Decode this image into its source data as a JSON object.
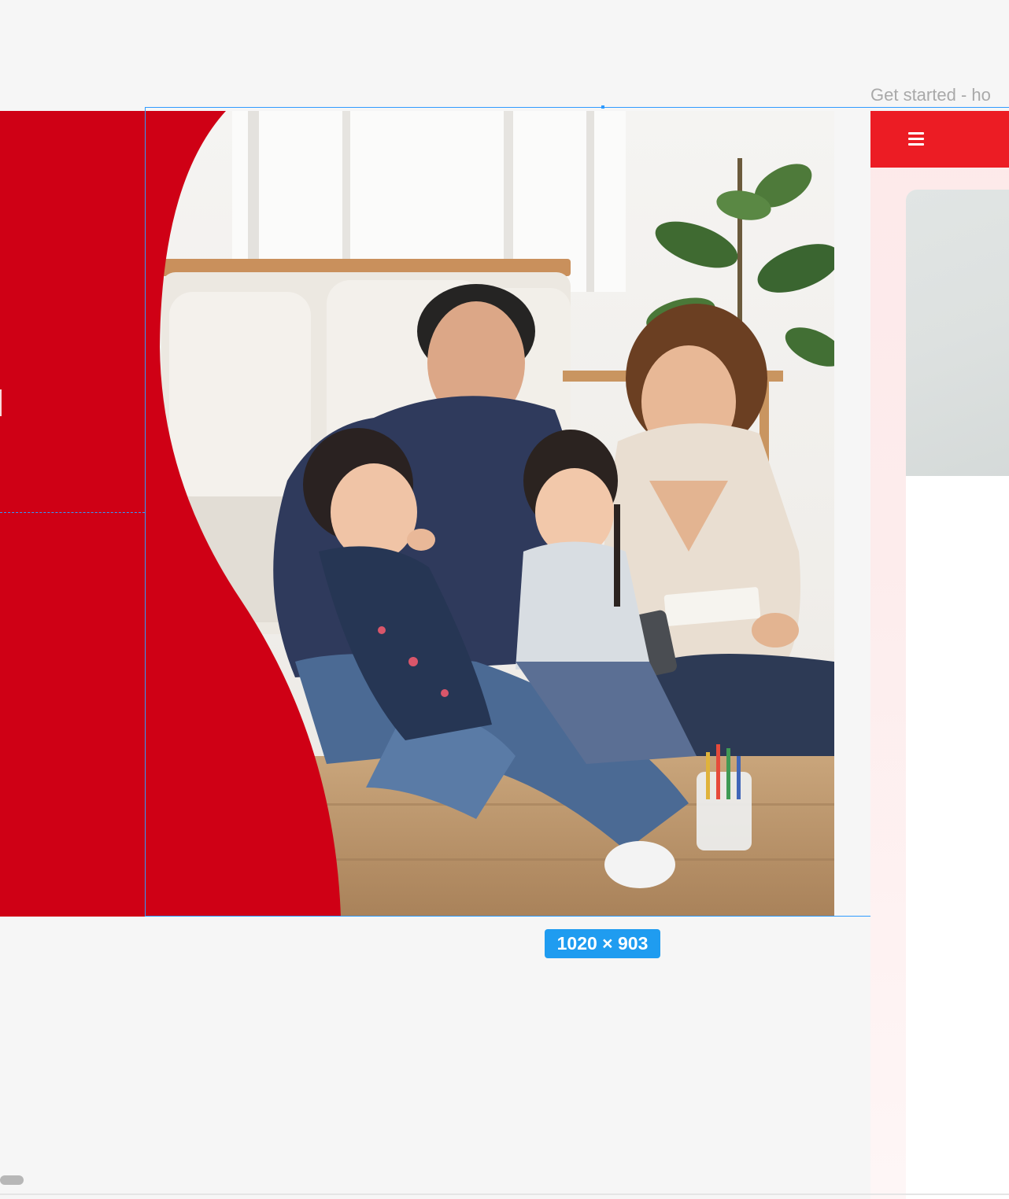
{
  "canvas": {
    "background": "#f6f6f6"
  },
  "selection": {
    "size_label": "1020 × 903",
    "outline_color": "#2f9bff"
  },
  "left_panel": {
    "color": "#cf0015"
  },
  "image": {
    "subject": "family-photo",
    "wave_color": "#cf0015"
  },
  "right_frame": {
    "title": "Get started - ho",
    "header_color": "#ec1c24",
    "menu_icon": "hamburger-menu-icon"
  }
}
